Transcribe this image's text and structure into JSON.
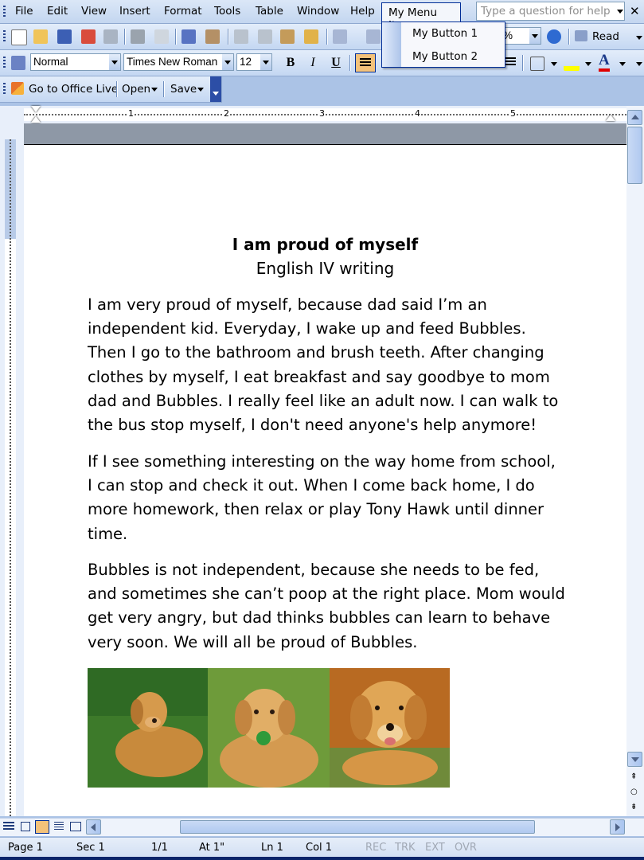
{
  "menubar": {
    "items": [
      "File",
      "Edit",
      "View",
      "Insert",
      "Format",
      "Tools",
      "Table",
      "Window",
      "Help"
    ],
    "custom_menu": "My Menu Item",
    "help_placeholder": "Type a question for help",
    "close_glyph": "✕"
  },
  "custom_menu_popup": {
    "items": [
      "My Button 1",
      "My Button 2"
    ]
  },
  "standard_toolbar": {
    "zoom_value": "%",
    "read_label": "Read"
  },
  "formatting_toolbar": {
    "style": "Normal",
    "font": "Times New Roman",
    "size": "12",
    "bold_label": "B",
    "italic_label": "I",
    "underline_label": "U"
  },
  "office_toolbar": {
    "go_live_label": "Go to Office Live",
    "open_label": "Open",
    "save_label": "Save"
  },
  "ruler": {
    "numbers": [
      "1",
      "2",
      "3",
      "4",
      "5"
    ]
  },
  "document": {
    "title": "I am proud of myself",
    "subtitle": "English IV writing",
    "paragraphs": [
      "I am very proud of myself, because dad said I’m an\nindependent kid. Everyday, I wake up and feed Bubbles.\nThen I go to the bathroom and brush teeth. After changing\nclothes by myself, I eat breakfast and say goodbye to mom\ndad and Bubbles. I really feel like an adult now. I can walk to\nthe bus stop myself, I don't need anyone's help anymore!",
      "If I see something interesting on the way home from school,\nI can stop and check it out. When I come back home, I do\nmore homework, then relax or play Tony Hawk until dinner\ntime.",
      "Bubbles is not independent, because she needs to be fed,\nand sometimes she can’t poop at the right place. Mom would\nget very angry, but dad thinks bubbles can learn to behave\nvery soon. We will all be proud of Bubbles."
    ]
  },
  "statusbar": {
    "page": "Page  1",
    "sec": "Sec  1",
    "pages": "1/1",
    "at": "At  1\"",
    "ln": "Ln  1",
    "col": "Col  1",
    "rec": "REC",
    "trk": "TRK",
    "ext": "EXT",
    "ovr": "OVR"
  },
  "colors": {
    "menubar_bg": "#c3d6f0",
    "accent_border": "#002d96",
    "highlight_btn": "#f4c27a",
    "page_strip": "#8e98a6"
  }
}
